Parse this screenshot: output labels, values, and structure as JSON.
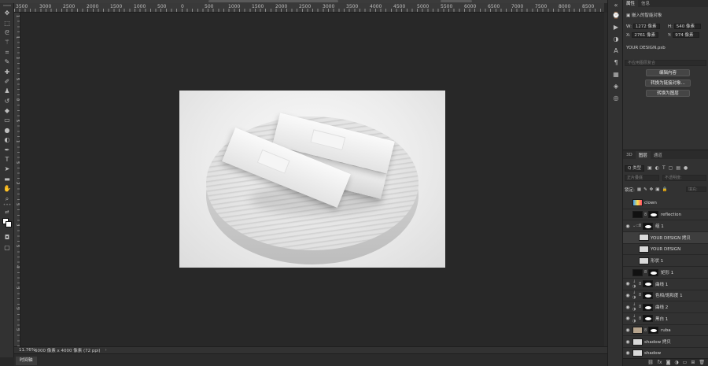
{
  "ruler": {
    "top_labels": [
      "3500",
      "3000",
      "2500",
      "2000",
      "1500",
      "1000",
      "500",
      "0",
      "500",
      "1000",
      "1500",
      "2000",
      "2500",
      "3000",
      "3500",
      "4000",
      "4500",
      "5000",
      "5500",
      "6000",
      "6500",
      "7000",
      "7500",
      "8000",
      "8500"
    ],
    "left_labels": [
      "1",
      "1",
      "1",
      "5",
      "0",
      "5",
      "1",
      "5",
      "2",
      "5",
      "3",
      "5",
      "4",
      "5",
      "5",
      "5"
    ]
  },
  "status": {
    "zoom": "11.76%",
    "doc_info": "6000 像素 x 4000 像素 (72 ppi)",
    "arrow": "›"
  },
  "timeline": {
    "tab_label": "时间轴"
  },
  "properties": {
    "tabs": [
      "属性",
      "信息"
    ],
    "type_label": "嵌入的智能对象",
    "w_label": "W:",
    "w_value": "1272 像素",
    "h_label": "H:",
    "h_value": "540 像素",
    "x_label": "X:",
    "x_value": "2761 像素",
    "y_label": "Y:",
    "y_value": "974 像素",
    "file_name": "YOUR DESIGN.psb",
    "comps_placeholder": "不应用图层复合",
    "buttons": [
      "编辑内容",
      "转换为链接对象...",
      "转换为图层"
    ]
  },
  "layers_panel": {
    "tabs": [
      "3D",
      "图层",
      "通道"
    ],
    "filter_kind": "Q 类型",
    "blend_mode": "正片叠底",
    "opacity_label": "不透明度:",
    "lock_label": "锁定:",
    "fill_label": "填充:",
    "layers": [
      {
        "name": "clown",
        "visible": false,
        "type": "image",
        "mask": false,
        "selected": false
      },
      {
        "name": "reflection",
        "visible": false,
        "type": "image",
        "mask": true,
        "selected": false
      },
      {
        "name": "组 1",
        "visible": true,
        "type": "group",
        "mask": true,
        "selected": false
      },
      {
        "name": "YOUR DESIGN 拷贝",
        "visible": false,
        "type": "smart",
        "mask": false,
        "selected": true
      },
      {
        "name": "YOUR DESIGN",
        "visible": false,
        "type": "smart",
        "mask": false,
        "selected": false
      },
      {
        "name": "形状 1",
        "visible": false,
        "type": "smart",
        "mask": false,
        "selected": false
      },
      {
        "name": "矩形 1",
        "visible": false,
        "type": "image",
        "mask": true,
        "selected": false
      },
      {
        "name": "曲线 1",
        "visible": true,
        "type": "adjust",
        "mask": true,
        "selected": false
      },
      {
        "name": "色相/饱和度 1",
        "visible": true,
        "type": "adjust",
        "mask": true,
        "selected": false
      },
      {
        "name": "曲线 2",
        "visible": true,
        "type": "adjust",
        "mask": true,
        "selected": false
      },
      {
        "name": "黑白 1",
        "visible": true,
        "type": "adjust",
        "mask": true,
        "selected": false
      },
      {
        "name": "ruba",
        "visible": true,
        "type": "image",
        "mask": true,
        "selected": false
      },
      {
        "name": "shadow 拷贝",
        "visible": true,
        "type": "image",
        "mask": false,
        "selected": false
      },
      {
        "name": "shadow",
        "visible": true,
        "type": "image",
        "mask": false,
        "selected": false
      }
    ]
  },
  "tools": [
    "move-icon",
    "marquee-icon",
    "lasso-icon",
    "magic-wand-icon",
    "crop-icon",
    "eyedropper-icon",
    "spot-heal-icon",
    "brush-icon",
    "stamp-icon",
    "history-brush-icon",
    "eraser-icon",
    "gradient-icon",
    "blur-icon",
    "dodge-icon",
    "pen-icon",
    "type-icon",
    "path-select-icon",
    "rectangle-icon",
    "hand-icon",
    "zoom-icon",
    "more-icon"
  ],
  "colors": {
    "foreground": "#ffffff",
    "background": "#ffffff",
    "ui_bg": "#323232",
    "canvas_bg": "#282828"
  }
}
